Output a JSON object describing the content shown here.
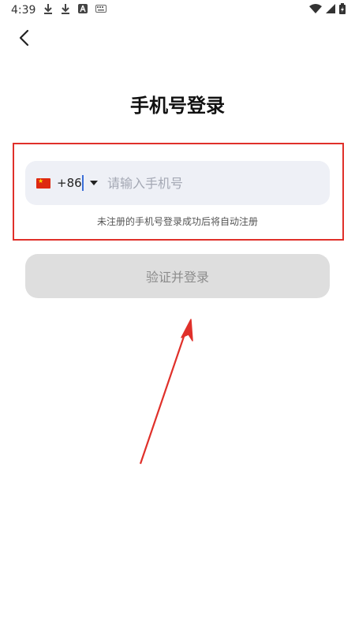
{
  "status_bar": {
    "time": "4:39",
    "left_icons": [
      "download-icon",
      "download-icon",
      "app-store-icon",
      "keyboard-icon"
    ],
    "right_icons": [
      "wifi-icon",
      "signal-icon",
      "battery-charging-icon"
    ]
  },
  "nav": {
    "back_icon": "chevron-left-icon"
  },
  "page": {
    "title": "手机号登录"
  },
  "phone_form": {
    "country_flag": "china-flag-icon",
    "country_code": "+86",
    "placeholder": "请输入手机号",
    "value": "",
    "hint": "未注册的手机号登录成功后将自动注册"
  },
  "submit": {
    "label": "验证并登录",
    "enabled": false
  },
  "annotations": {
    "highlight_color": "#e0302a",
    "arrow_color": "#e0302a"
  },
  "colors": {
    "field_background": "#eef0f6",
    "button_disabled_background": "#dedede",
    "button_disabled_text": "#8c8c8c"
  }
}
